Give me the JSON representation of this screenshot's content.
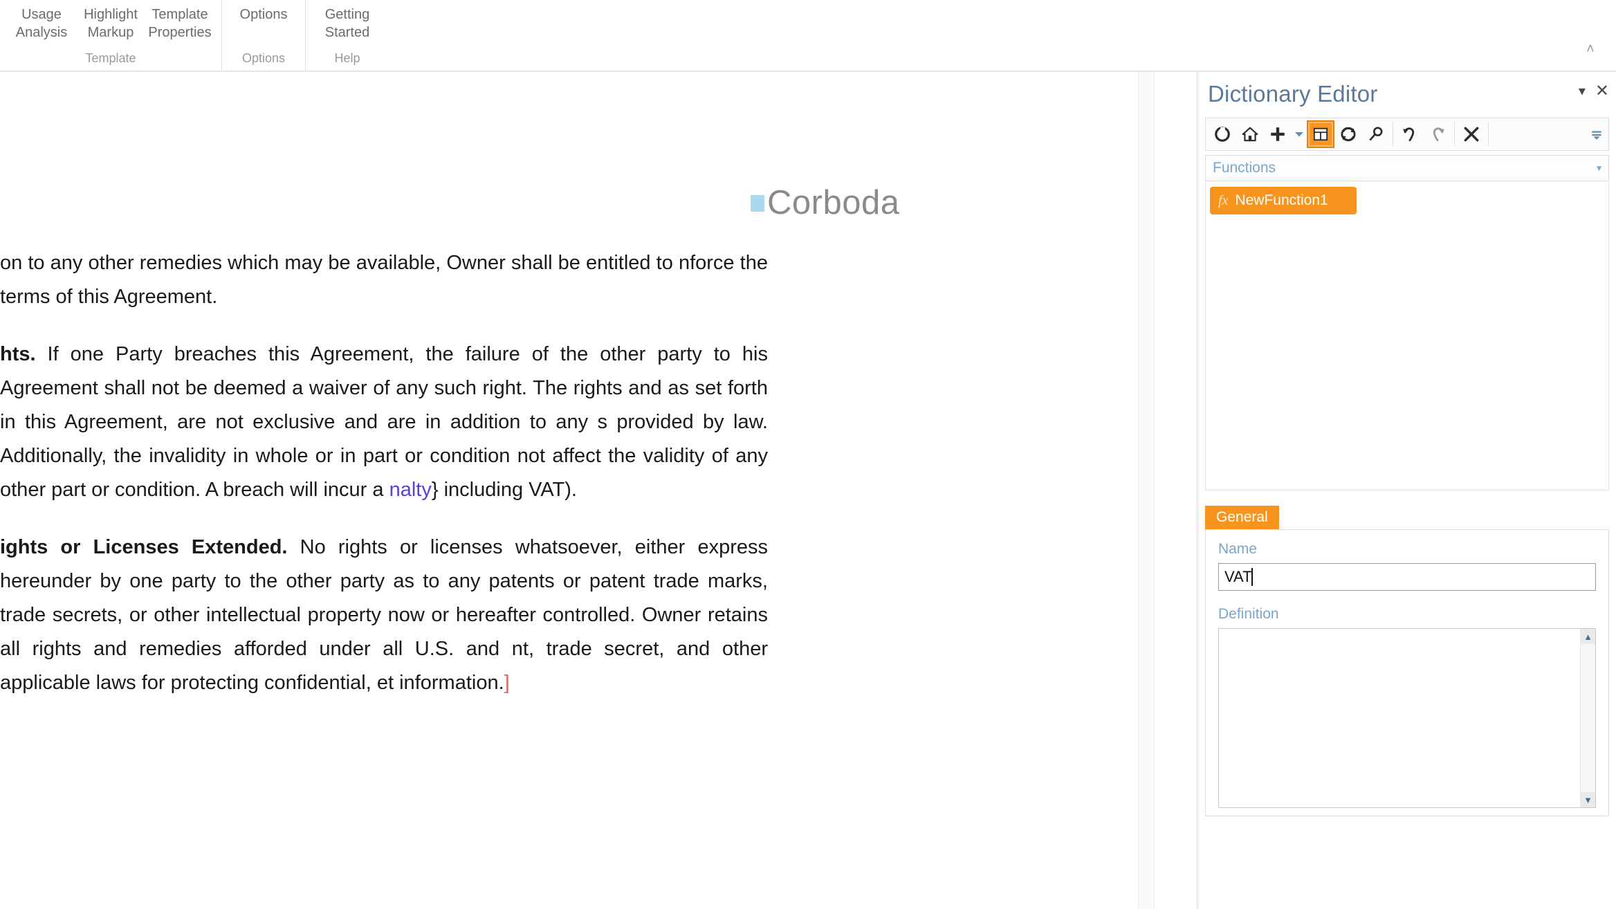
{
  "ribbon": {
    "groups": [
      {
        "name": "Template",
        "label": "Template",
        "items": [
          {
            "line1": "Usage",
            "line2": "Analysis",
            "icon": "usage-analysis-icon"
          },
          {
            "line1": "Highlight",
            "line2": "Markup",
            "icon": "highlight-markup-icon"
          },
          {
            "line1": "Template",
            "line2": "Properties",
            "icon": "template-properties-icon"
          }
        ]
      },
      {
        "name": "Options",
        "label": "Options",
        "items": [
          {
            "line1": "Options",
            "line2": "",
            "icon": "options-icon"
          }
        ]
      },
      {
        "name": "Help",
        "label": "Help",
        "items": [
          {
            "line1": "Getting",
            "line2": "Started",
            "icon": "getting-started-icon"
          }
        ]
      }
    ],
    "collapse_glyph": "˄"
  },
  "document": {
    "logo": {
      "wordmark": "Corboda",
      "square_color": "#a9d8ef",
      "text_color": "#8a8a8a"
    },
    "paragraphs": [
      {
        "id": "p-remedies",
        "runs": [
          {
            "text": "on to any other remedies which may be available, Owner shall be entitled to ",
            "style": "normal"
          },
          {
            "text": "nforce the terms of this Agreement.",
            "style": "normal"
          }
        ]
      },
      {
        "id": "p-rights",
        "runs": [
          {
            "text": "hts.",
            "style": "bold"
          },
          {
            "text": " If one Party breaches this Agreement, the failure of the other party to ",
            "style": "normal"
          },
          {
            "text": "his Agreement shall not be deemed a waiver of any such right.  The rights and ",
            "style": "normal"
          },
          {
            "text": "as set forth in this Agreement, are not exclusive and are in addition to any ",
            "style": "normal"
          },
          {
            "text": "s provided by law.  Additionally, the invalidity in whole or in part or condition ",
            "style": "normal"
          },
          {
            "text": "not affect the validity of any other part or condition. A breach will incur a ",
            "style": "normal"
          },
          {
            "text": "nalty",
            "style": "field"
          },
          {
            "text": "} including VAT).",
            "style": "normal"
          }
        ]
      },
      {
        "id": "p-licenses",
        "runs": [
          {
            "text": "ights or Licenses Extended.",
            "style": "bold"
          },
          {
            "text": " No rights or licenses whatsoever, either express ",
            "style": "normal"
          },
          {
            "text": " hereunder by one party to the other party as to any patents or patent ",
            "style": "normal"
          },
          {
            "text": " trade marks, trade secrets, or other intellectual property now or hereafter ",
            "style": "normal"
          },
          {
            "text": "controlled.  Owner retains all rights and remedies afforded under all U.S. and ",
            "style": "normal"
          },
          {
            "text": "nt, trade secret, and other applicable laws for protecting confidential, ",
            "style": "normal"
          },
          {
            "text": "et information.",
            "style": "normal"
          },
          {
            "text": "]",
            "style": "red"
          }
        ]
      }
    ]
  },
  "panel": {
    "title": "Dictionary Editor",
    "header_buttons": [
      {
        "name": "panel-dropdown-button",
        "glyph": "▾"
      },
      {
        "name": "panel-close-button",
        "glyph": "✕"
      }
    ],
    "toolbar": [
      {
        "name": "back-icon",
        "tooltip": "Back",
        "active": false
      },
      {
        "name": "home-icon",
        "tooltip": "Home",
        "active": false
      },
      {
        "name": "add-icon",
        "tooltip": "Add",
        "active": false
      },
      {
        "name": "add-dropdown-icon",
        "tooltip": "Add options",
        "active": false
      },
      {
        "name": "table-view-icon",
        "tooltip": "Table view",
        "active": true
      },
      {
        "name": "refresh-icon",
        "tooltip": "Refresh",
        "active": false
      },
      {
        "name": "search-icon",
        "tooltip": "Search",
        "active": false
      },
      {
        "name": "undo-icon",
        "tooltip": "Undo",
        "active": false
      },
      {
        "name": "redo-icon",
        "tooltip": "Redo",
        "active": false
      },
      {
        "name": "delete-icon",
        "tooltip": "Delete",
        "active": false
      },
      {
        "name": "overflow-menu-icon",
        "tooltip": "More",
        "active": false
      }
    ],
    "category_combo": {
      "selected": "Functions",
      "arrow": "▾"
    },
    "list": {
      "items": [
        {
          "label": "NewFunction1",
          "icon": "fx-icon",
          "icon_glyph": "fx",
          "selected": true
        }
      ]
    },
    "tabs": [
      {
        "label": "General",
        "active": true
      }
    ],
    "fields": {
      "name_label": "Name",
      "name_value": "VAT",
      "definition_label": "Definition",
      "definition_value": ""
    },
    "scrollbar": {
      "up_glyph": "▲",
      "down_glyph": "▼"
    },
    "colors": {
      "accent_orange": "#f7941e",
      "accent_orange_dark": "#e8800c",
      "label_blue": "#7aa6cc",
      "title_blue": "#5b7a99"
    }
  }
}
